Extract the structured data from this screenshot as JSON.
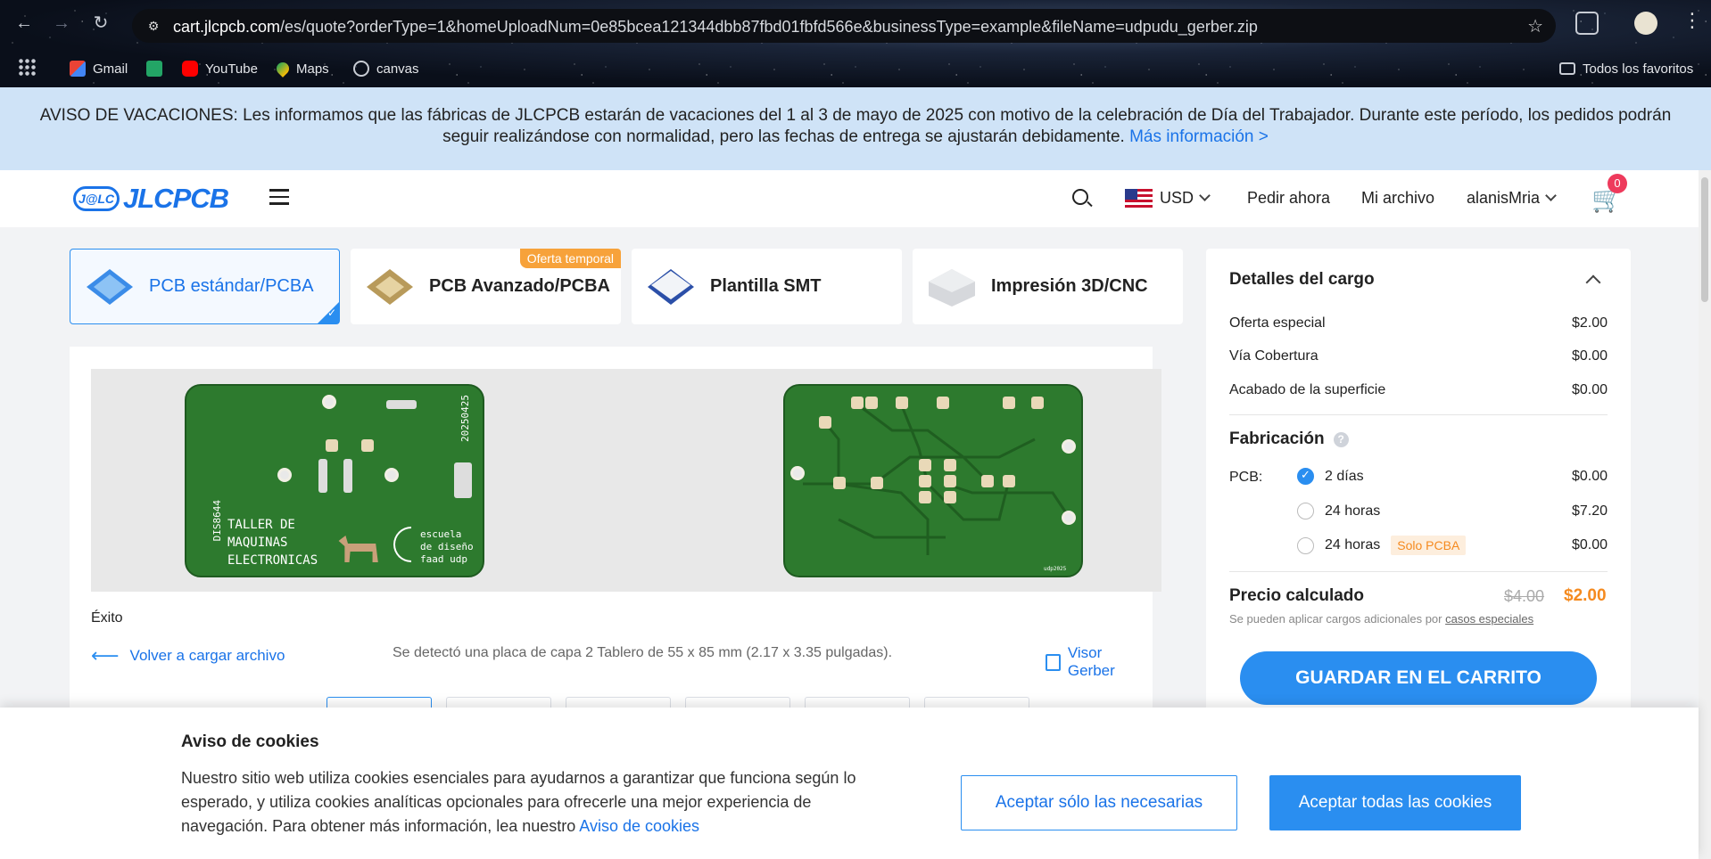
{
  "browser": {
    "url_host": "cart.jlcpcb.com",
    "url_path": "/es/quote?orderType=1&homeUploadNum=0e85bcea121344dbb87fbd01fbfd566e&businessType=example&fileName=udpudu_gerber.zip",
    "bookmarks": [
      "Gmail",
      "YouTube",
      "Maps",
      "canvas"
    ],
    "all_bookmarks": "Todos los favoritos"
  },
  "notice": {
    "text": "AVISO DE VACACIONES: Les informamos que las fábricas de JLCPCB estarán de vacaciones del 1 al 3 de mayo de 2025 con motivo de la celebración de Día del Trabajador. Durante este período, los pedidos podrán seguir realizándose con normalidad, pero las fechas de entrega se ajustarán debidamente.",
    "link": "Más información >"
  },
  "header": {
    "logo_mark": "J@LC",
    "logo_text": "JLCPCB",
    "currency": "USD",
    "order_now": "Pedir ahora",
    "my_files": "Mi archivo",
    "username": "alanisMria",
    "cart_count": "0"
  },
  "product_tabs": [
    {
      "label": "PCB estándar/PCBA"
    },
    {
      "label": "PCB Avanzado/PCBA",
      "ribbon": "Oferta temporal"
    },
    {
      "label": "Plantilla SMT"
    },
    {
      "label": "Impresión 3D/CNC"
    }
  ],
  "preview": {
    "front_text": [
      "TALLER DE",
      "MAQUINAS",
      "ELECTRONICAS"
    ],
    "front_brand": [
      "escuela",
      "de diseño",
      "faad udp"
    ],
    "front_date": "20250425",
    "front_code": "DIS8644",
    "back_text": "udp2025",
    "status": "Éxito",
    "back_link": "Volver a cargar archivo",
    "detected": "Se detectó una placa de capa 2 Tablero de 55 x 85 mm (2.17 x 3.35 pulgadas).",
    "gerber_viewer": "Visor Gerber"
  },
  "charges": {
    "title": "Detalles del cargo",
    "rows": [
      {
        "label": "Oferta especial",
        "value": "$2.00"
      },
      {
        "label": "Vía Cobertura",
        "value": "$0.00"
      },
      {
        "label": "Acabado de la superficie",
        "value": "$0.00"
      }
    ],
    "fabrication_title": "Fabricación",
    "pcb_label": "PCB:",
    "options": [
      {
        "label": "2 días",
        "value": "$0.00",
        "checked": true
      },
      {
        "label": "24 horas",
        "value": "$7.20"
      },
      {
        "label": "24 horas",
        "tag": "Solo PCBA",
        "value": "$0.00"
      }
    ],
    "calc_label": "Precio calculado",
    "old_price": "$4.00",
    "new_price": "$2.00",
    "note_prefix": "Se pueden aplicar cargos adicionales por ",
    "note_link": "casos especiales",
    "cart_button": "GUARDAR EN EL CARRITO"
  },
  "cookie": {
    "title": "Aviso de cookies",
    "body": "Nuestro sitio web utiliza cookies esenciales para ayudarnos a garantizar que funciona según lo esperado, y utiliza cookies analíticas opcionales para ofrecerle una mejor experiencia de navegación. Para obtener más información, lea nuestro",
    "link": "Aviso de cookies",
    "btn_necessary": "Aceptar sólo las necesarias",
    "btn_all": "Aceptar todas las cookies"
  },
  "colors": {
    "accent": "#2a8ef0",
    "price_orange": "#f58a1f",
    "notice_bg": "#cfe3f7",
    "pcb_green": "#2d7a2e"
  }
}
